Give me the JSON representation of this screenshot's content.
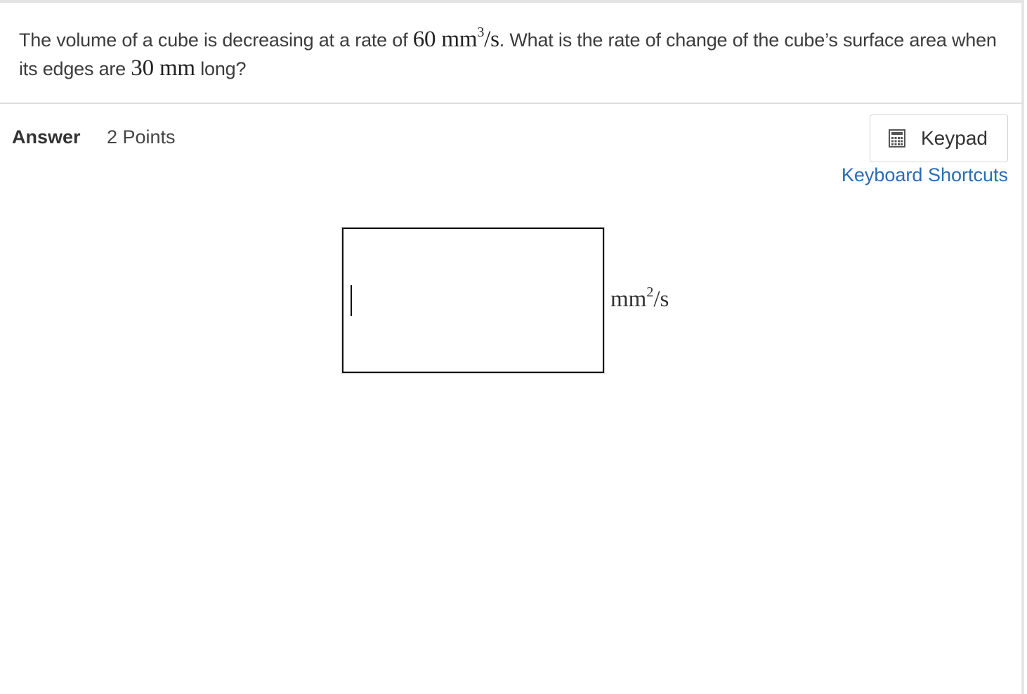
{
  "question": {
    "part1": "The volume of a cube is decreasing at a rate of ",
    "rate_value": "60",
    "rate_unit_base": "mm",
    "rate_unit_exp": "3",
    "rate_unit_tail": "/s",
    "part2": ". What is the rate of change of the cube’s surface area when its edges are ",
    "edge_value": "30",
    "edge_unit": "mm",
    "part3": " long?"
  },
  "answer": {
    "label": "Answer",
    "points": "2 Points",
    "value": "",
    "unit_base": "mm",
    "unit_exp": "2",
    "unit_tail": "/s"
  },
  "toolbar": {
    "keypad_label": "Keypad",
    "keypad_icon": "calculator-icon",
    "shortcuts_label": "Keyboard Shortcuts"
  },
  "colors": {
    "link": "#2b6cb0",
    "text": "#333333"
  }
}
